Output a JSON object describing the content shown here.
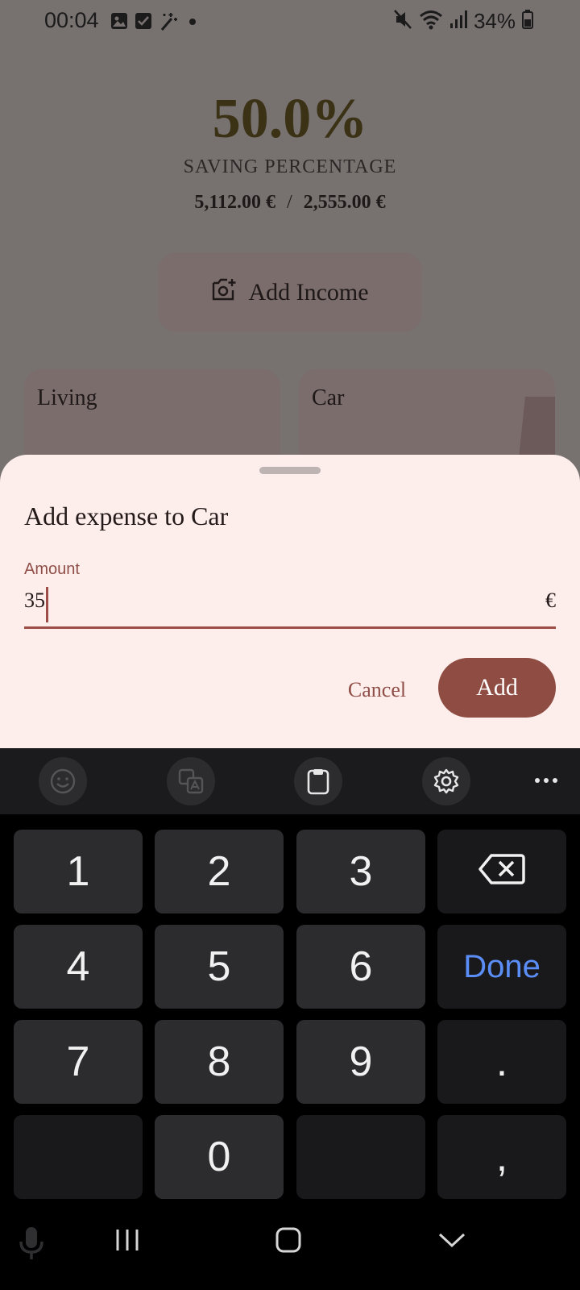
{
  "status_bar": {
    "time": "00:04",
    "battery": "34%",
    "left_icons": [
      "image-icon",
      "checkbox-icon",
      "magic-wand-icon",
      "dot-icon"
    ],
    "right_icons": [
      "mute-icon",
      "wifi-icon",
      "signal-icon",
      "battery-icon"
    ]
  },
  "summary": {
    "percentage": "50.0%",
    "label": "SAVING PERCENTAGE",
    "income": "5,112.00 €",
    "separator": "/",
    "savings": "2,555.00 €"
  },
  "add_income": {
    "label": "Add Income",
    "icon": "add-photo-icon"
  },
  "cards": [
    {
      "title": "Living"
    },
    {
      "title": "Car"
    }
  ],
  "sheet": {
    "title": "Add expense to Car",
    "amount_label": "Amount",
    "amount_value": "35",
    "currency": "€",
    "cancel": "Cancel",
    "add": "Add"
  },
  "keyboard": {
    "toolbar_icons": [
      "emoji-icon",
      "translate-icon",
      "clipboard-icon",
      "settings-icon",
      "more-icon"
    ],
    "keys": {
      "k1": "1",
      "k2": "2",
      "k3": "3",
      "k4": "4",
      "k5": "5",
      "k6": "6",
      "k7": "7",
      "k8": "8",
      "k9": "9",
      "k0": "0",
      "done": "Done",
      "period": ".",
      "comma": ","
    }
  },
  "nav_bar": {
    "icons": [
      "microphone-icon",
      "recents-icon",
      "home-icon",
      "hide-keyboard-icon"
    ]
  }
}
